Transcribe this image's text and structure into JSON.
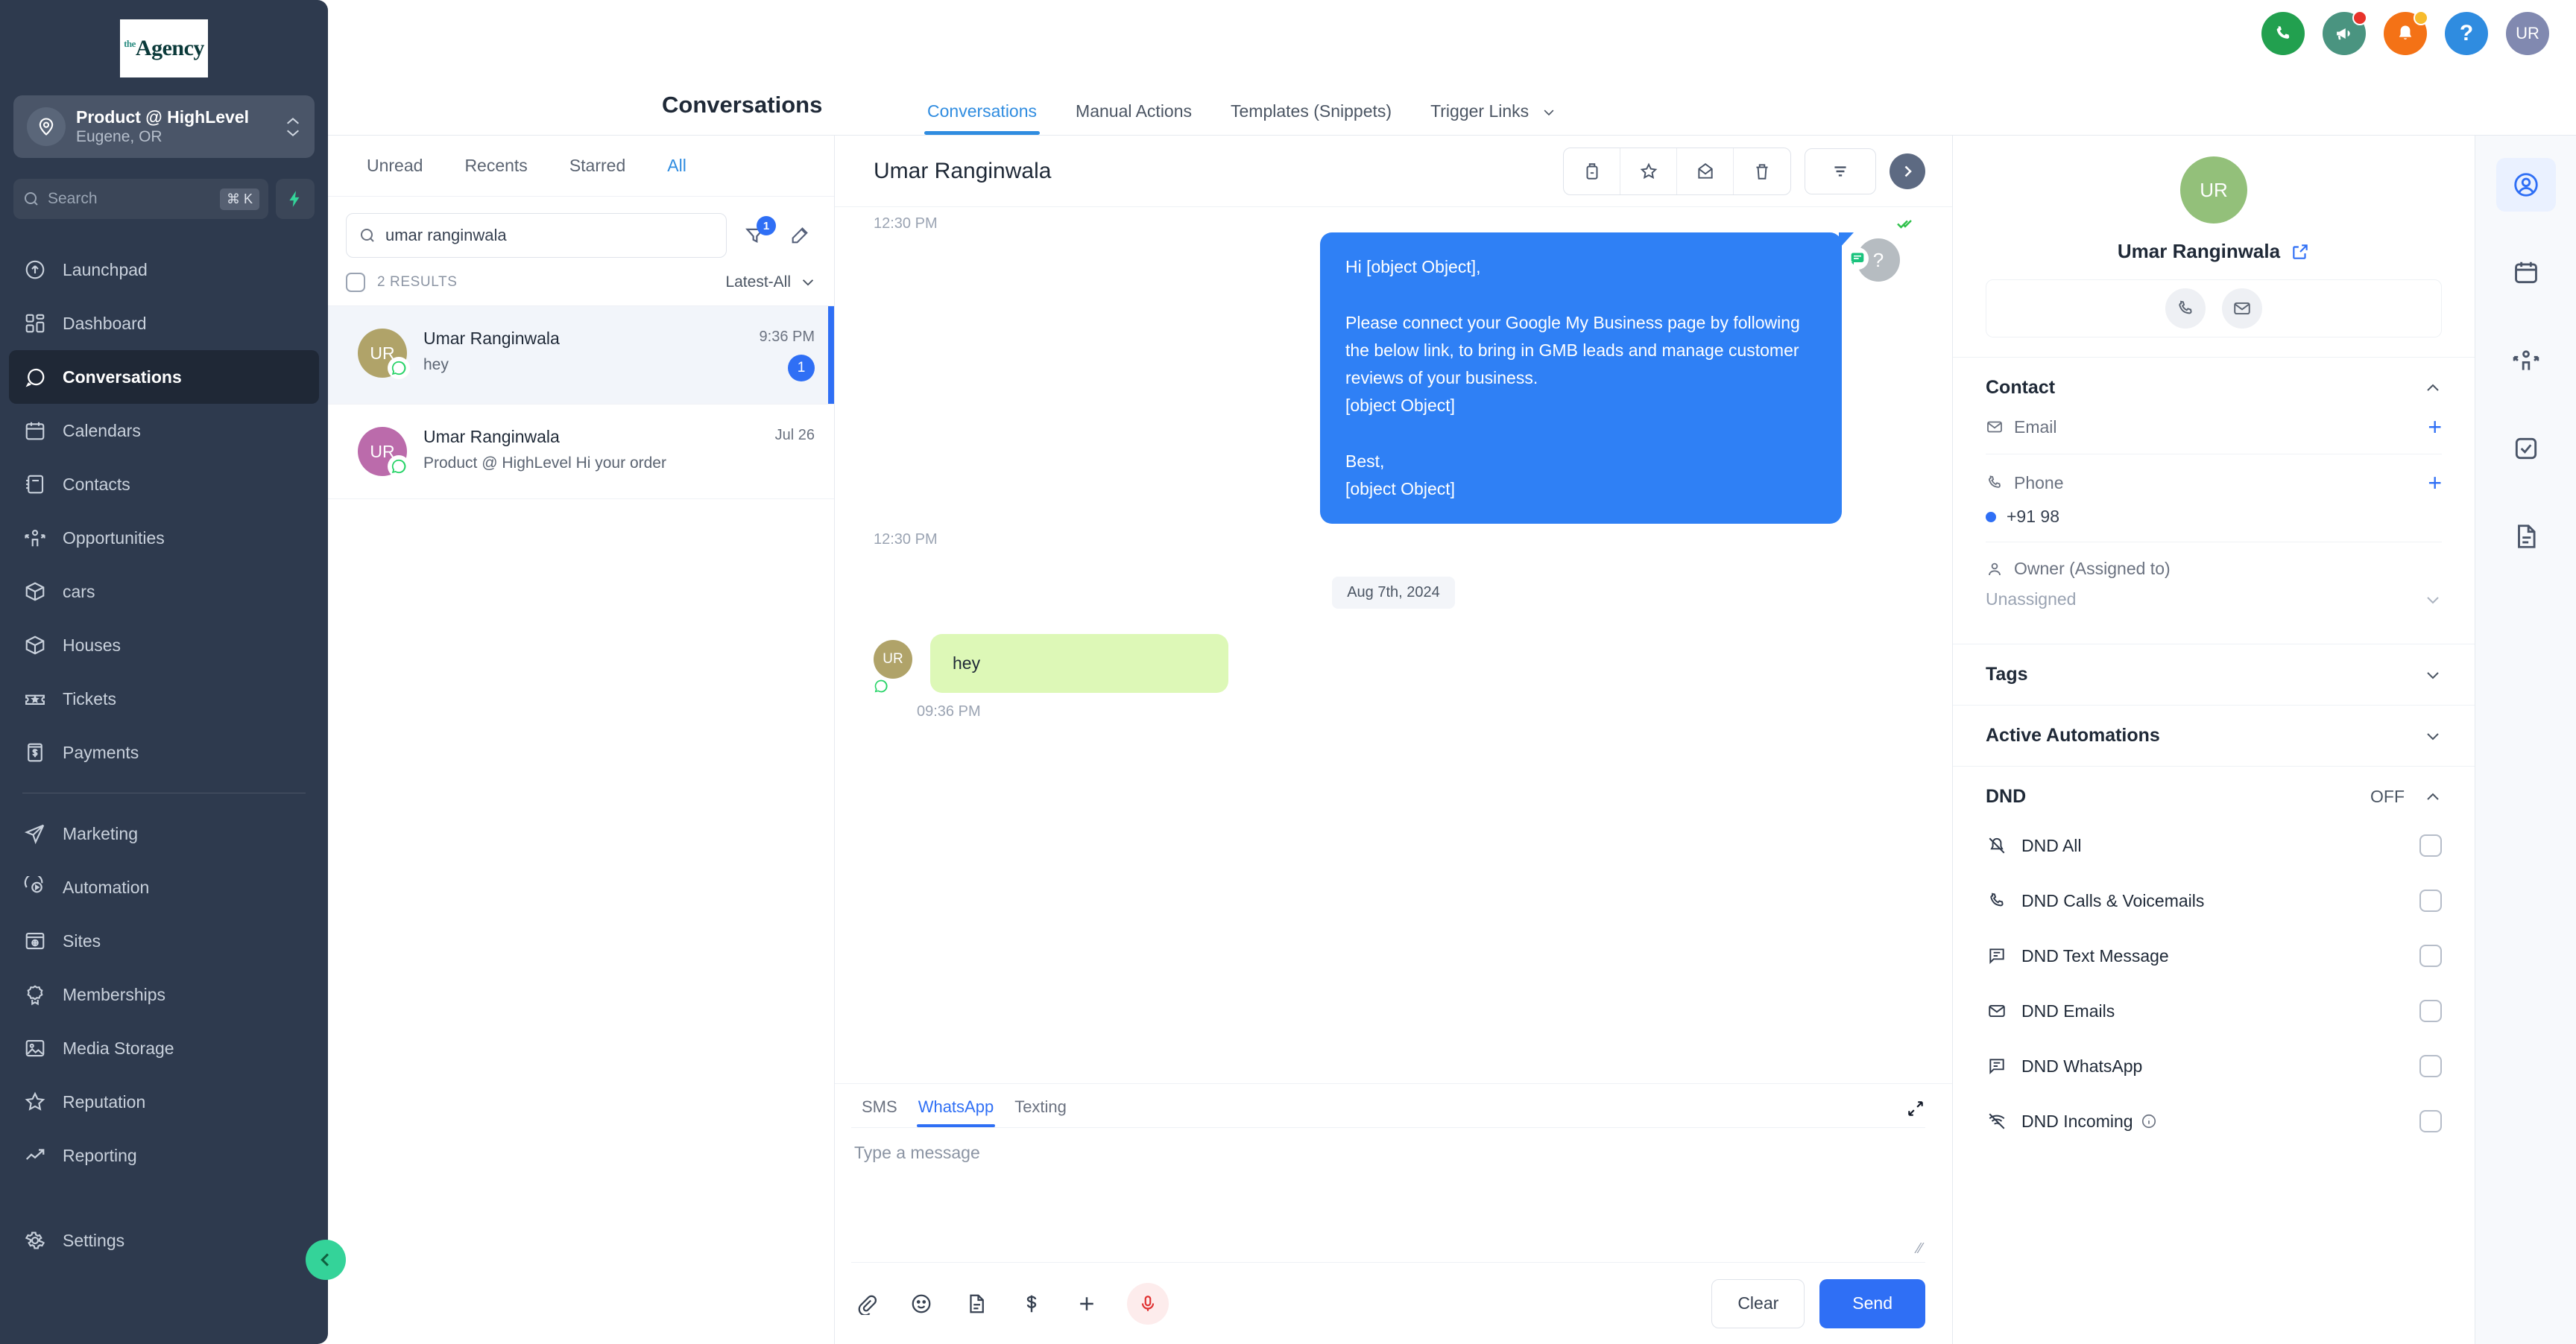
{
  "sidebar": {
    "logo": {
      "sup": "the",
      "name": "Agency"
    },
    "location": {
      "name": "Product @ HighLevel",
      "sub": "Eugene, OR",
      "icon": "location-pin-icon"
    },
    "search": {
      "placeholder": "Search",
      "shortcut": "⌘ K",
      "icon": "search-icon",
      "bolt_icon": "lightning-bolt-icon"
    },
    "items": [
      {
        "label": "Launchpad",
        "icon": "rocket-icon",
        "active": false
      },
      {
        "label": "Dashboard",
        "icon": "dashboard-grid-icon",
        "active": false
      },
      {
        "label": "Conversations",
        "icon": "chat-bubble-icon",
        "active": true
      },
      {
        "label": "Calendars",
        "icon": "calendar-icon",
        "active": false
      },
      {
        "label": "Contacts",
        "icon": "contacts-book-icon",
        "active": false
      },
      {
        "label": "Opportunities",
        "icon": "opportunities-icon",
        "active": false
      },
      {
        "label": "cars",
        "icon": "box-icon",
        "active": false
      },
      {
        "label": "Houses",
        "icon": "box-icon",
        "active": false
      },
      {
        "label": "Tickets",
        "icon": "ticket-icon",
        "active": false
      },
      {
        "label": "Payments",
        "icon": "payments-icon",
        "active": false
      }
    ],
    "items2": [
      {
        "label": "Marketing",
        "icon": "paper-plane-icon"
      },
      {
        "label": "Automation",
        "icon": "play-circle-icon"
      },
      {
        "label": "Sites",
        "icon": "browser-globe-icon"
      },
      {
        "label": "Memberships",
        "icon": "ribbon-badge-icon"
      },
      {
        "label": "Media Storage",
        "icon": "image-icon"
      },
      {
        "label": "Reputation",
        "icon": "star-icon"
      },
      {
        "label": "Reporting",
        "icon": "trending-up-icon"
      }
    ],
    "items3": [
      {
        "label": "Settings",
        "icon": "gear-icon"
      }
    ],
    "collapse_icon": "chevron-left-icon"
  },
  "topbar": {
    "buttons": [
      {
        "name": "phone-dialer",
        "icon": "phone-icon",
        "color": "#22a04f",
        "badge": null
      },
      {
        "name": "announcements",
        "icon": "megaphone-icon",
        "color": "#4a9480",
        "badge": "#e8332a"
      },
      {
        "name": "notifications",
        "icon": "bell-icon",
        "color": "#f47216",
        "badge": "#f7bb2c"
      },
      {
        "name": "help",
        "icon": "question-mark-icon",
        "color": "#2f8ce0",
        "badge": null
      }
    ],
    "avatar": {
      "initials": "UR",
      "color": "#8189b0"
    }
  },
  "header": {
    "page_title": "Conversations",
    "tabs": [
      {
        "label": "Conversations",
        "active": true
      },
      {
        "label": "Manual Actions",
        "active": false
      },
      {
        "label": "Templates (Snippets)",
        "active": false
      },
      {
        "label": "Trigger Links",
        "active": false,
        "caret": true
      }
    ]
  },
  "conversation_list": {
    "filter_tabs": [
      {
        "label": "Unread",
        "active": false
      },
      {
        "label": "Recents",
        "active": false
      },
      {
        "label": "Starred",
        "active": false
      },
      {
        "label": "All",
        "active": true
      }
    ],
    "search": {
      "value": "umar ranginwala",
      "placeholder": "Search",
      "icon": "search-icon"
    },
    "filter_button": {
      "icon": "filter-funnel-icon",
      "badge": "1"
    },
    "compose_button": {
      "icon": "compose-pencil-icon"
    },
    "results_count": "2 RESULTS",
    "sort": {
      "label": "Latest-All",
      "icon": "chevron-down-icon"
    },
    "items": [
      {
        "name": "Umar Ranginwala",
        "preview": "hey",
        "time": "9:36 PM",
        "unread": "1",
        "avatar_initials": "UR",
        "avatar_color": "#b0a369",
        "channel_icon": "whatsapp-icon",
        "selected": true
      },
      {
        "name": "Umar Ranginwala",
        "preview": "Product @ HighLevel Hi your order",
        "time": "Jul 26",
        "unread": null,
        "avatar_initials": "UR",
        "avatar_color": "#bb6bab",
        "channel_icon": "whatsapp-icon",
        "selected": false
      }
    ]
  },
  "thread": {
    "title": "Umar Ranginwala",
    "toolbar": [
      {
        "name": "archive-button",
        "icon": "archive-box-icon"
      },
      {
        "name": "star-button",
        "icon": "star-icon"
      },
      {
        "name": "mark-unread-button",
        "icon": "envelope-open-icon"
      },
      {
        "name": "delete-button",
        "icon": "trash-icon"
      }
    ],
    "filter_button": {
      "icon": "filter-lines-icon"
    },
    "next_button": {
      "icon": "chevron-right-icon"
    },
    "messages": [
      {
        "direction": "outgoing",
        "time_top": "12:30 PM",
        "time_bottom": "12:30 PM",
        "status_icon": "double-check-icon",
        "avatar_initials": "?",
        "avatar_color": "#b6bcc1",
        "channel_icon": "whatsapp-green-icon",
        "text": "Hi [object Object],\n\nPlease connect your Google My Business page by following the below link, to bring in GMB leads and manage customer reviews of your business.\n[object Object]\n\nBest,\n[object Object]"
      },
      {
        "direction": "incoming",
        "date_divider": "Aug 7th, 2024",
        "avatar_initials": "UR",
        "avatar_color": "#b0a369",
        "channel_icon": "whatsapp-icon",
        "text": "hey",
        "time_bottom": "09:36 PM"
      }
    ]
  },
  "composer": {
    "tabs": [
      {
        "label": "SMS",
        "active": false
      },
      {
        "label": "WhatsApp",
        "active": true
      },
      {
        "label": "Texting",
        "active": false
      }
    ],
    "expand_icon": "expand-diagonal-icon",
    "placeholder": "Type a message",
    "tools": [
      {
        "name": "attach-file",
        "icon": "paperclip-icon"
      },
      {
        "name": "emoji-picker",
        "icon": "smiley-icon"
      },
      {
        "name": "insert-template",
        "icon": "document-lines-icon"
      },
      {
        "name": "insert-payment",
        "icon": "dollar-icon"
      },
      {
        "name": "more-options",
        "icon": "plus-icon"
      },
      {
        "name": "record-audio",
        "icon": "microphone-icon"
      }
    ],
    "clear_label": "Clear",
    "send_label": "Send"
  },
  "contact_panel": {
    "avatar": {
      "initials": "UR",
      "color": "#93c07a"
    },
    "name": "Umar Ranginwala",
    "external_link_icon": "external-link-icon",
    "quick_actions": [
      {
        "name": "call-contact",
        "icon": "phone-icon"
      },
      {
        "name": "email-contact",
        "icon": "envelope-icon"
      }
    ],
    "sections": [
      {
        "title": "Contact",
        "expanded": true,
        "chevron": "chevron-up-icon"
      },
      {
        "title": "Tags",
        "expanded": false,
        "chevron": "chevron-down-icon"
      },
      {
        "title": "Active Automations",
        "expanded": false,
        "chevron": "chevron-down-icon"
      },
      {
        "title": "DND",
        "expanded": true,
        "status": "OFF",
        "chevron": "chevron-up-icon"
      }
    ],
    "fields": [
      {
        "label": "Email",
        "icon": "envelope-icon",
        "value": null,
        "add_icon": "plus-icon"
      },
      {
        "label": "Phone",
        "icon": "phone-icon",
        "value": "+91 98",
        "add_icon": "plus-icon"
      },
      {
        "label": "Owner (Assigned to)",
        "icon": "user-icon",
        "value": "Unassigned",
        "chevron": "chevron-down-icon"
      }
    ],
    "dnd_items": [
      {
        "label": "DND All",
        "icon": "bell-off-icon",
        "checked": false
      },
      {
        "label": "DND Calls & Voicemails",
        "icon": "phone-icon",
        "checked": false
      },
      {
        "label": "DND Text Message",
        "icon": "chat-lines-icon",
        "checked": false
      },
      {
        "label": "DND Emails",
        "icon": "envelope-icon",
        "checked": false
      },
      {
        "label": "DND WhatsApp",
        "icon": "chat-lines-icon",
        "checked": false
      },
      {
        "label": "DND Incoming",
        "icon": "signal-off-icon",
        "checked": false,
        "info_icon": "info-circle-icon"
      }
    ]
  },
  "rail": {
    "buttons": [
      {
        "name": "contact-tab",
        "icon": "user-circle-icon",
        "active": true
      },
      {
        "name": "appointments-tab",
        "icon": "calendar-icon",
        "active": false
      },
      {
        "name": "opportunities-tab",
        "icon": "opportunities-icon",
        "active": false
      },
      {
        "name": "tasks-tab",
        "icon": "checkbox-square-icon",
        "active": false
      },
      {
        "name": "documents-tab",
        "icon": "document-lines-icon",
        "active": false
      }
    ]
  },
  "colors": {
    "accent_blue": "#2f6ff5",
    "tab_blue": "#2f8ce0",
    "outgoing_bubble": "#2f80f5",
    "incoming_bubble": "#ddf8b7",
    "sidebar_bg": "#2e3a4e"
  }
}
